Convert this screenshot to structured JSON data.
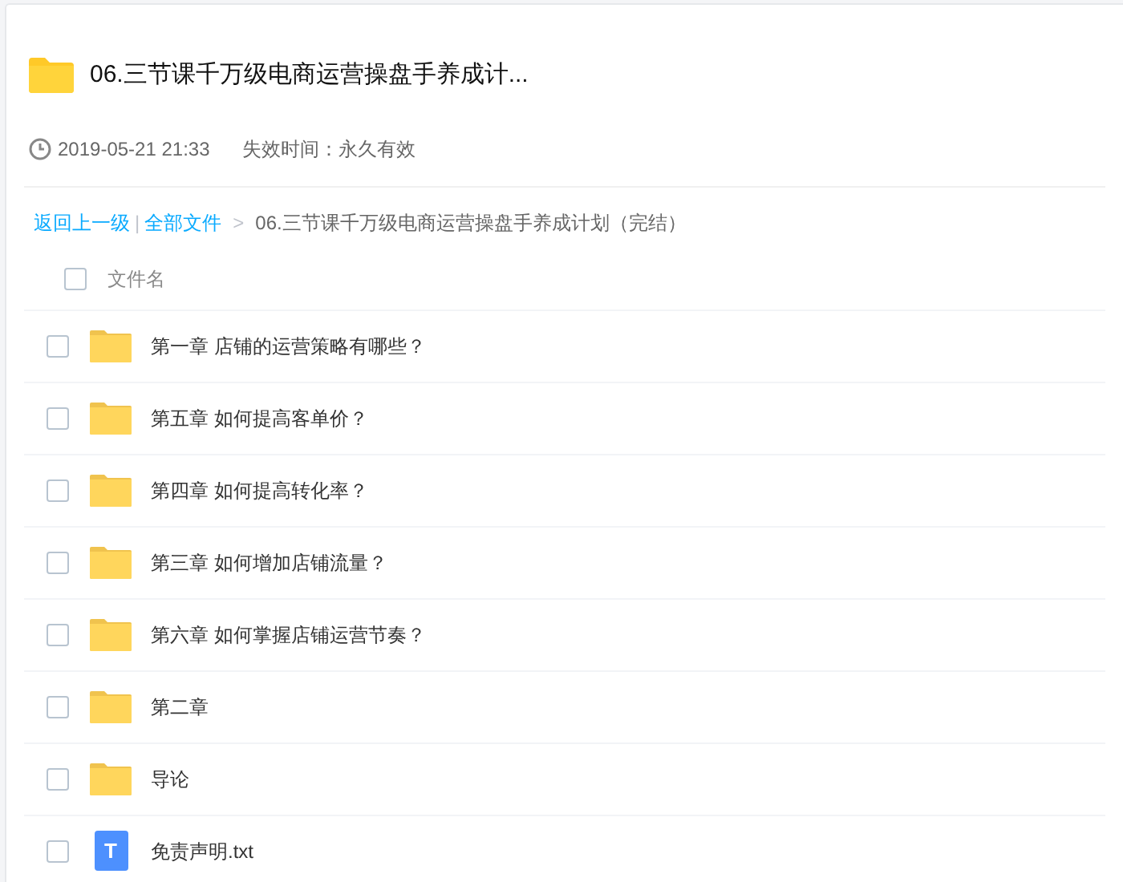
{
  "share": {
    "title": "06.三节课千万级电商运营操盘手养成计...",
    "date": "2019-05-21 21:33",
    "expiry": "失效时间：永久有效"
  },
  "breadcrumb": {
    "back": "返回上一级",
    "separator": "|",
    "all": "全部文件",
    "arrow": ">",
    "current": "06.三节课千万级电商运营操盘手养成计划（完结）"
  },
  "table": {
    "header": {
      "label": "文件名",
      "checked": false
    },
    "rows": [
      {
        "kind": "folder",
        "name": "第一章 店铺的运营策略有哪些？",
        "checked": false
      },
      {
        "kind": "folder",
        "name": "第五章 如何提高客单价？",
        "checked": false
      },
      {
        "kind": "folder",
        "name": "第四章 如何提高转化率？",
        "checked": false
      },
      {
        "kind": "folder",
        "name": "第三章 如何增加店铺流量？",
        "checked": false
      },
      {
        "kind": "folder",
        "name": "第六章 如何掌握店铺运营节奏？",
        "checked": false
      },
      {
        "kind": "folder",
        "name": "第二章",
        "checked": false
      },
      {
        "kind": "folder",
        "name": "导论",
        "checked": false
      },
      {
        "kind": "file",
        "name": "免责声明.txt",
        "icon_letter": "T",
        "checked": false
      }
    ]
  }
}
